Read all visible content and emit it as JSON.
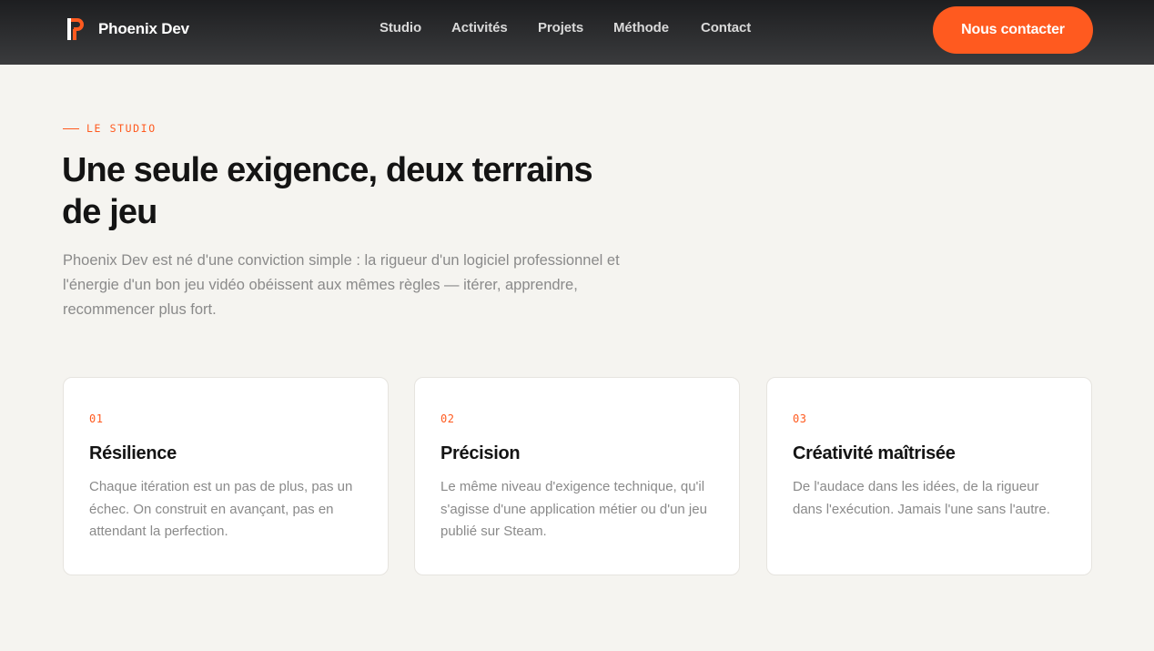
{
  "nav": {
    "brand": "Phoenix Dev",
    "links": [
      "Studio",
      "Activités",
      "Projets",
      "Méthode",
      "Contact"
    ],
    "cta": "Nous contacter"
  },
  "hero": {
    "eyebrow": "LE STUDIO",
    "title": "Une seule exigence, deux terrains de jeu",
    "lead": "Phoenix Dev est né d'une conviction simple : la rigueur d'un logiciel professionnel et l'énergie d'un bon jeu vidéo obéissent aux mêmes règles — itérer, apprendre, recommencer plus fort."
  },
  "cards": [
    {
      "num": "01",
      "title": "Résilience",
      "body": "Chaque itération est un pas de plus, pas un échec. On construit en avançant, pas en attendant la perfection."
    },
    {
      "num": "02",
      "title": "Précision",
      "body": "Le même niveau d'exigence technique, qu'il s'agisse d'une application métier ou d'un jeu publié sur Steam."
    },
    {
      "num": "03",
      "title": "Créativité maîtrisée",
      "body": "De l'audace dans les idées, de la rigueur dans l'exécution. Jamais l'une sans l'autre."
    }
  ],
  "colors": {
    "accent": "#ff5a1f",
    "background": "#f5f4f0",
    "navbar": "#2b2c2e"
  },
  "icons": {
    "brand_logo": "phoenix-logo-icon"
  }
}
